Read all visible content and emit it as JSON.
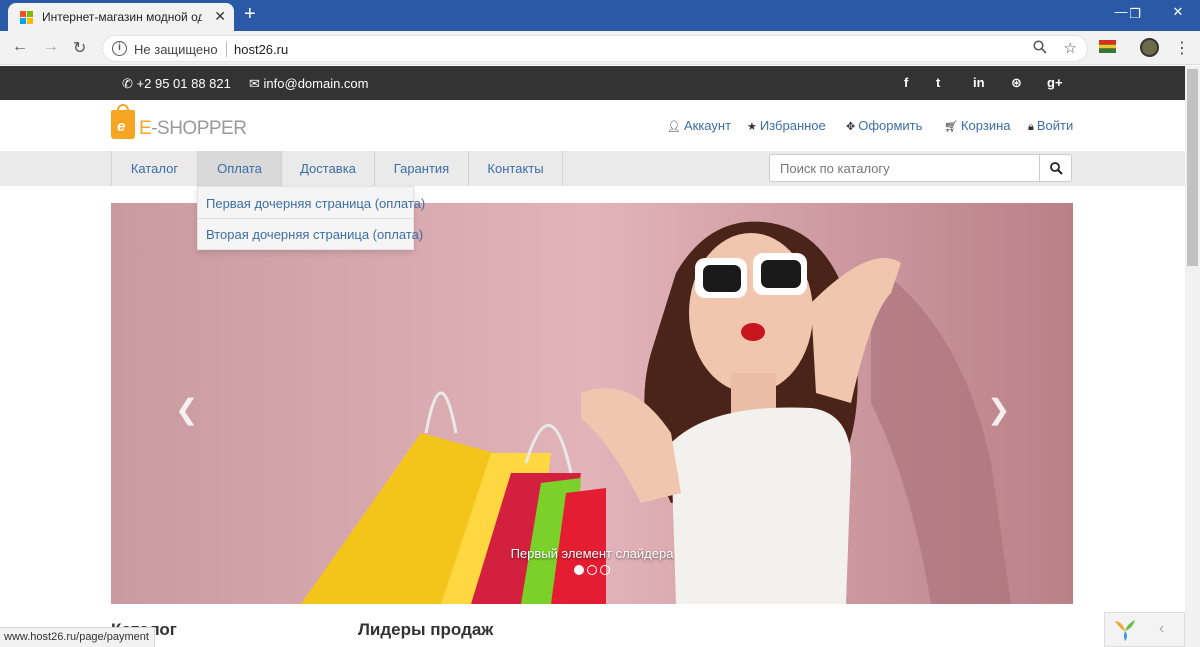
{
  "browser": {
    "tab_title": "Интернет-магазин модной оде",
    "security_label": "Не защищено",
    "url": "host26.ru",
    "status_url": "www.host26.ru/page/payment"
  },
  "topbar": {
    "phone": "+2 95 01 88 821",
    "email": "info@domain.com",
    "social": [
      {
        "name": "facebook-icon",
        "glyph": "f"
      },
      {
        "name": "twitter-icon",
        "glyph": "t"
      },
      {
        "name": "linkedin-icon",
        "glyph": "in"
      },
      {
        "name": "dribbble-icon",
        "glyph": "⊛"
      },
      {
        "name": "google-plus-icon",
        "glyph": "g+"
      }
    ]
  },
  "logo": {
    "letter": "e",
    "text_prefix": "E",
    "text_rest": "-SHOPPER"
  },
  "header_links": {
    "account": "Аккаунт",
    "favorites": "Избранное",
    "checkout": "Оформить",
    "cart": "Корзина",
    "login": "Войти"
  },
  "nav": {
    "items": [
      "Каталог",
      "Оплата",
      "Доставка",
      "Гарантия",
      "Контакты"
    ],
    "active": "Оплата",
    "dropdown": [
      "Первая дочерняя страница (оплата)",
      "Вторая дочерняя страница (оплата)"
    ]
  },
  "search": {
    "placeholder": "Поиск по каталогу"
  },
  "slider": {
    "caption": "Первый элемент слайдера",
    "slide_count": 3,
    "active_slide": 1
  },
  "sections": {
    "left": "Каталог",
    "right": "Лидеры продаж"
  },
  "colors": {
    "link": "#3c6ea7",
    "topbar": "#333333",
    "accent": "#f6a623",
    "slide_bg": "#d4a6ab"
  }
}
